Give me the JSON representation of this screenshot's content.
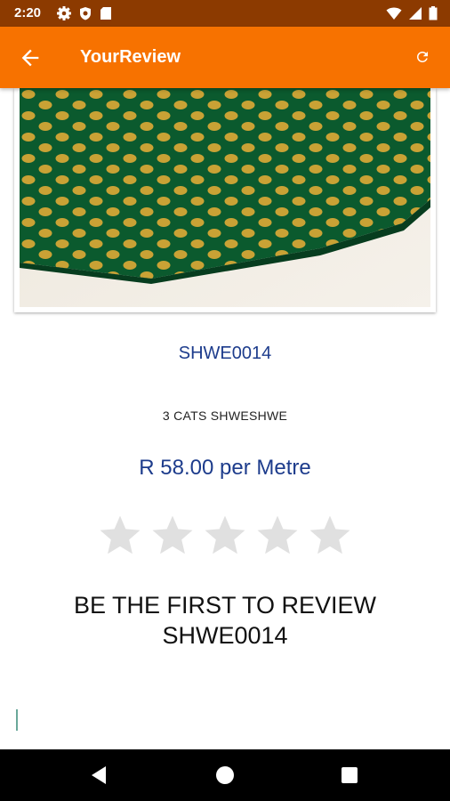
{
  "status_bar": {
    "time": "2:20",
    "icons": [
      "gear-icon",
      "shield-icon",
      "sd-card-icon",
      "wifi-icon",
      "signal-icon",
      "battery-icon"
    ]
  },
  "app_bar": {
    "title": "YourReview",
    "back_icon": "arrow-back-icon",
    "refresh_icon": "refresh-icon",
    "color": "#f77200"
  },
  "product": {
    "code": "SHWE0014",
    "name": "3 CATS SHWESHWE",
    "price": "R 58.00 per Metre",
    "image": "green fabric with gold polka dots"
  },
  "rating": {
    "max": 5,
    "value": 0
  },
  "review": {
    "prompt_line1": "BE THE FIRST TO REVIEW",
    "prompt_line2": "SHWE0014",
    "input_value": ""
  },
  "nav_bar": {
    "icons": [
      "back-triangle-icon",
      "home-circle-icon",
      "recents-square-icon"
    ]
  },
  "colors": {
    "status_bar": "#8c3a00",
    "accent_text": "#1d3c8c",
    "star_empty": "#e0e0e0"
  }
}
